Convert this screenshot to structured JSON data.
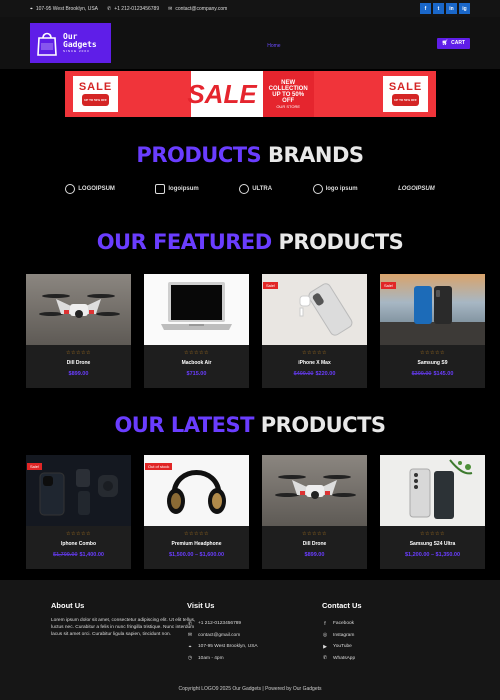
{
  "topbar": {
    "address": "107-95 West Brooklyn, USA",
    "phone": "+1 212-0123456789",
    "email": "contact@company.com",
    "socials": [
      "f",
      "t",
      "in",
      "ig"
    ]
  },
  "header": {
    "logo_line1": "Our",
    "logo_line2": "Gadgets",
    "logo_sub": "SINCE 2003",
    "nav_home": "Home",
    "cart_label": "CART"
  },
  "banner": {
    "left_tag": "SALE",
    "left_pill": "UP TO 50% OFF",
    "mid_big": "SALE",
    "mid_heading": "NEW COLLECTION",
    "mid_sub": "UP TO 50% OFF",
    "mid_link": "OUR STORE",
    "right_tag": "SALE",
    "right_pill": "UP TO 50% OFF"
  },
  "brands_section": {
    "title_accent": "PRODUCTS",
    "title_rest": "BRANDS",
    "brands": [
      "LOGOIPSUM",
      "logoipsum",
      "ULTRA",
      "logo ipsum",
      "LOGOIPSUM"
    ]
  },
  "featured": {
    "title_accent": "OUR FEATURED",
    "title_rest": "PRODUCTS",
    "products": [
      {
        "name": "Dill Drone",
        "old_price": "",
        "price": "$899.00",
        "badge": "",
        "rating": "☆☆☆☆☆"
      },
      {
        "name": "Macbook Air",
        "old_price": "",
        "price": "$715.00",
        "badge": "",
        "rating": "☆☆☆☆☆"
      },
      {
        "name": "iPhone X Max",
        "old_price": "$400.00",
        "price": "$220.00",
        "badge": "Sale!",
        "rating": "☆☆☆☆☆"
      },
      {
        "name": "Samsung S9",
        "old_price": "$300.00",
        "price": "$145.00",
        "badge": "Sale!",
        "rating": "☆☆☆☆☆"
      }
    ]
  },
  "latest": {
    "title_accent": "OUR LATEST",
    "title_rest": "PRODUCTS",
    "products": [
      {
        "name": "Iphone Combo",
        "old_price": "$1,700.00",
        "price": "$1,400.00",
        "badge": "Sale!",
        "rating": "☆☆☆☆☆"
      },
      {
        "name": "Premium Headphone",
        "old_price": "",
        "price": "$1,500.00 – $1,600.00",
        "badge": "Out of stock",
        "rating": "☆☆☆☆☆"
      },
      {
        "name": "Dill Drone",
        "old_price": "",
        "price": "$899.00",
        "badge": "",
        "rating": "☆☆☆☆☆"
      },
      {
        "name": "Samsung S24 Ultra",
        "old_price": "",
        "price": "$1,200.00 – $1,350.00",
        "badge": "",
        "rating": "☆☆☆☆☆"
      }
    ]
  },
  "footer": {
    "about_title": "About Us",
    "about_text": "Lorem ipsum dolor sit amet, consectetur adipiscing elit. Ut elit tellus, luctus nec. Curabitur a felis in nunc fringilla tristique. Nunc interdum lacus sit amet orci. Curabitur ligula sapien, tincidunt non.",
    "visit_title": "Visit Us",
    "visit_items": [
      "+1 212-0123456789",
      "contact@gmail.com",
      "107-95 West Brooklyn, USA",
      "10am - 4pm"
    ],
    "contact_title": "Contact Us",
    "contact_items": [
      "Facebook",
      "Instagram",
      "YouTube",
      "WhatsApp"
    ],
    "copyright": "Copyright LOGO9 2025 Our Gadgets | Powered by Our Gadgets"
  }
}
